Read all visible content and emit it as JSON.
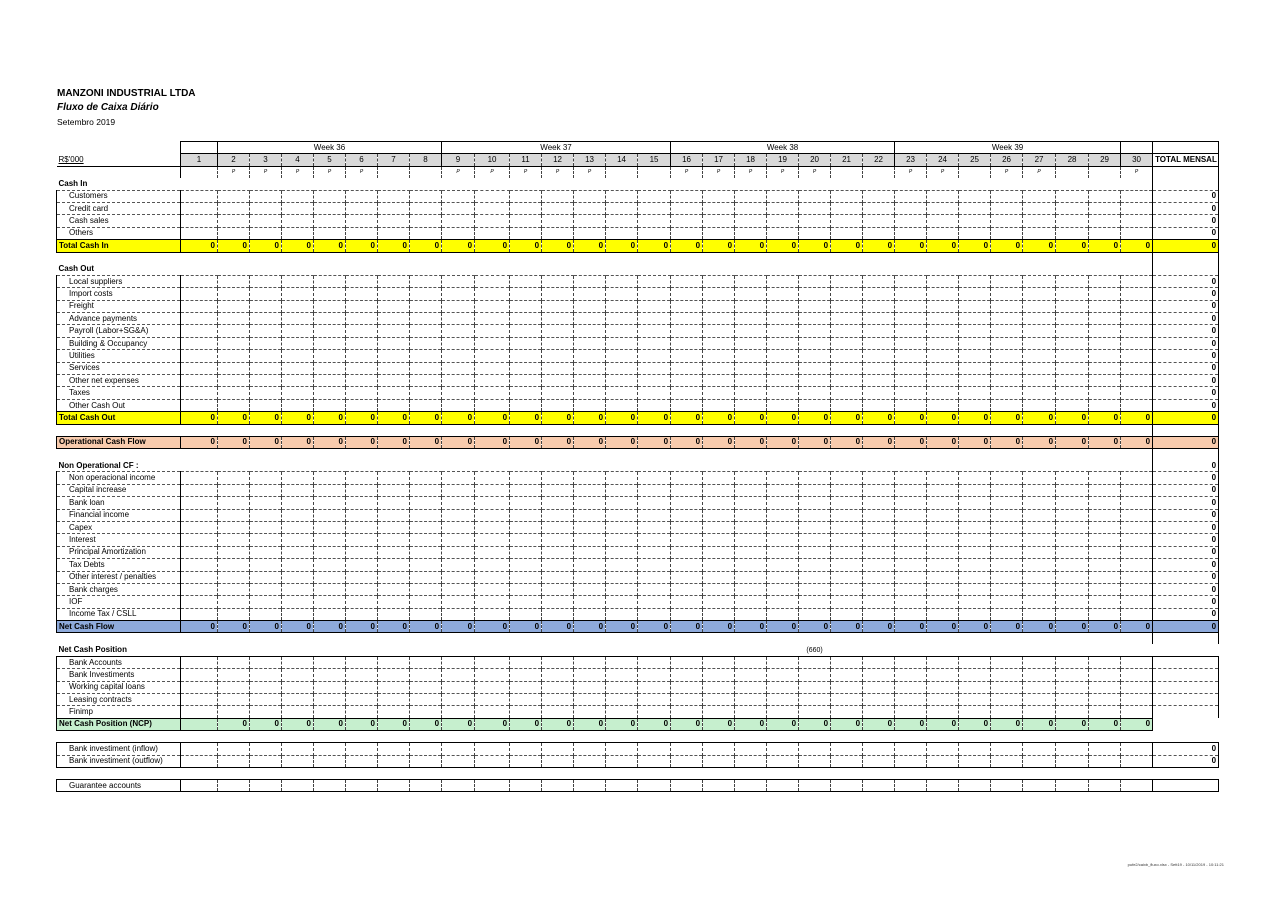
{
  "header": {
    "company": "MANZONI INDUSTRIAL LTDA",
    "subtitle": "Fluxo de Caixa Diário",
    "period": "Setembro 2019",
    "currency_label": "R$'000",
    "total_label": "TOTAL MENSAL"
  },
  "weeks": [
    "Week 36",
    "Week 37",
    "Week 38",
    "Week 39"
  ],
  "days": [
    "1",
    "2",
    "3",
    "4",
    "5",
    "6",
    "7",
    "8",
    "9",
    "10",
    "11",
    "12",
    "13",
    "14",
    "15",
    "16",
    "17",
    "18",
    "19",
    "20",
    "21",
    "22",
    "23",
    "24",
    "25",
    "26",
    "27",
    "28",
    "29",
    "30"
  ],
  "p_mark": "P",
  "sections": {
    "cash_in": {
      "title": "Cash In",
      "items": [
        "Customers",
        "Credit card",
        "Cash sales",
        "Others"
      ],
      "item_totals": [
        "0",
        "0",
        "0",
        "0"
      ],
      "total_label": "Total Cash In",
      "total_value": "0"
    },
    "cash_out": {
      "title": "Cash Out",
      "items": [
        "Local suppliers",
        "Import costs",
        "Freight",
        "Advance payments",
        "Payroll (Labor+SG&A)",
        "Building & Occupancy",
        "Utilities",
        "Services",
        "Other net expenses",
        "Taxes",
        "Other Cash Out"
      ],
      "item_totals": [
        "0",
        "0",
        "0",
        "0",
        "0",
        "0",
        "0",
        "0",
        "0",
        "0",
        "0"
      ],
      "total_label": "Total Cash Out",
      "total_value": "0"
    },
    "operational": {
      "label": "Operational Cash Flow",
      "total_value": "0"
    },
    "non_operational": {
      "title": "Non Operational CF :",
      "title_total": "0",
      "items": [
        "Non operacional income",
        "Capital increase",
        "Bank loan",
        "Financial income",
        "Capex",
        "Interest",
        "Principal Amortization",
        "Tax Debts",
        "Other interest / penalties",
        "Bank charges",
        "IOF",
        "Income Tax / CSLL"
      ],
      "item_totals": [
        "0",
        "0",
        "0",
        "0",
        "0",
        "0",
        "0",
        "0",
        "0",
        "0",
        "0",
        "0"
      ]
    },
    "net_cash_flow": {
      "label": "Net Cash Flow",
      "total_value": "0"
    },
    "net_cash_position": {
      "title": "Net Cash Position",
      "note_value": "(660)",
      "items": [
        "Bank Accounts",
        "Bank Investiments",
        "Working capital loans",
        "Leasing contracts",
        "Finimp"
      ],
      "total_label": "Net Cash Position (NCP)"
    },
    "bank_investment": {
      "items": [
        "Bank investiment (inflow)",
        "Bank investiment (outflow)"
      ],
      "item_totals": [
        "0",
        "0"
      ]
    },
    "guarantee": {
      "items": [
        "Guarantee accounts"
      ]
    }
  },
  "zero": "0",
  "footer_text": "pufe2/caixb_fluxo.xlsx - Sett19 - 10/11/2019 - 10:11:21"
}
